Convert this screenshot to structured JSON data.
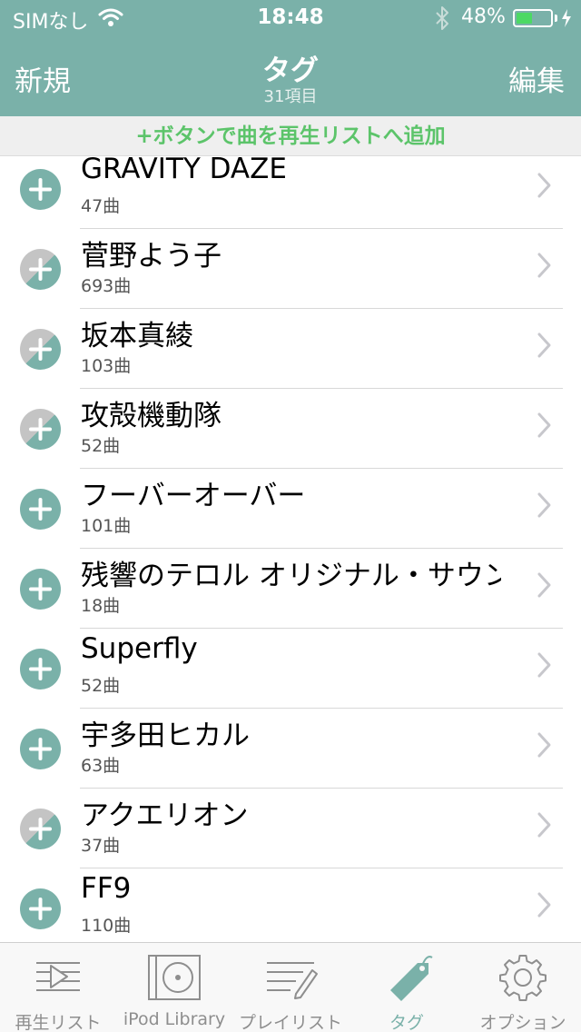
{
  "status": {
    "carrier": "SIMなし",
    "time": "18:48",
    "battery": "48%",
    "battery_level": 0.48
  },
  "nav": {
    "left": "新規",
    "title": "タグ",
    "subtitle": "31項目",
    "right": "編集"
  },
  "hint": "+ボタンで曲を再生リストへ追加",
  "rows": [
    {
      "title": "GRAVITY DAZE",
      "count": "47曲",
      "state": "full"
    },
    {
      "title": "菅野よう子",
      "count": "693曲",
      "state": "partial"
    },
    {
      "title": "坂本真綾",
      "count": "103曲",
      "state": "partial"
    },
    {
      "title": "攻殻機動隊",
      "count": "52曲",
      "state": "partial"
    },
    {
      "title": "フーバーオーバー",
      "count": "101曲",
      "state": "full"
    },
    {
      "title": "残響のテロル オリジナル・サウンドトラック",
      "count": "18曲",
      "state": "full"
    },
    {
      "title": "Superfly",
      "count": "52曲",
      "state": "full"
    },
    {
      "title": "宇多田ヒカル",
      "count": "63曲",
      "state": "full"
    },
    {
      "title": "アクエリオン",
      "count": "37曲",
      "state": "partial"
    },
    {
      "title": "FF9",
      "count": "110曲",
      "state": "full"
    }
  ],
  "tabs": [
    {
      "label": "再生リスト",
      "icon": "play-queue-icon"
    },
    {
      "label": "iPod Library",
      "icon": "ipod-icon"
    },
    {
      "label": "プレイリスト",
      "icon": "playlist-icon"
    },
    {
      "label": "タグ",
      "icon": "tag-icon",
      "active": true
    },
    {
      "label": "オプション",
      "icon": "gear-icon"
    }
  ],
  "colors": {
    "accent": "#7ab1a9",
    "hint": "#5cc46a",
    "partial": "#c4c4c4"
  }
}
